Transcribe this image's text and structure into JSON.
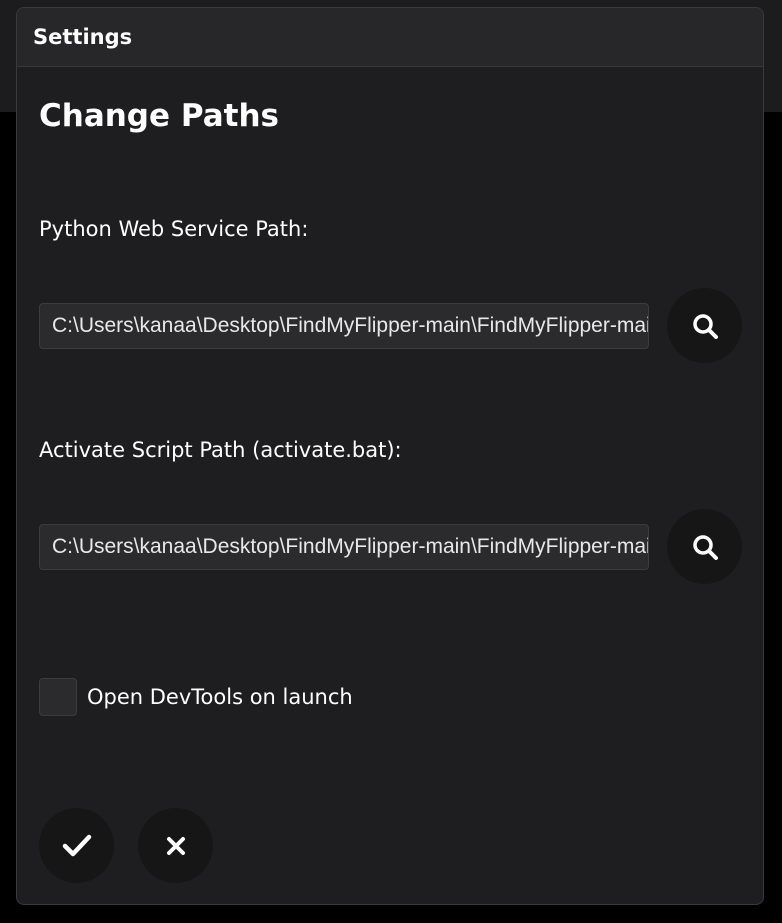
{
  "dialog": {
    "title": "Settings",
    "heading": "Change Paths"
  },
  "python_path": {
    "label": "Python Web Service Path:",
    "value": "C:\\Users\\kanaa\\Desktop\\FindMyFlipper-main\\FindMyFlipper-main"
  },
  "activate_path": {
    "label": "Activate Script Path (activate.bat):",
    "value": "C:\\Users\\kanaa\\Desktop\\FindMyFlipper-main\\FindMyFlipper-main"
  },
  "devtools": {
    "label": "Open DevTools on launch",
    "checked": false
  },
  "icons": {
    "browse": "search-icon",
    "confirm": "check-icon",
    "cancel": "close-icon"
  },
  "colors": {
    "dialog_bg": "#1e1e20",
    "header_bg": "#27272a",
    "input_bg": "#2b2b2d",
    "button_bg": "#161617",
    "text": "#ffffff"
  }
}
